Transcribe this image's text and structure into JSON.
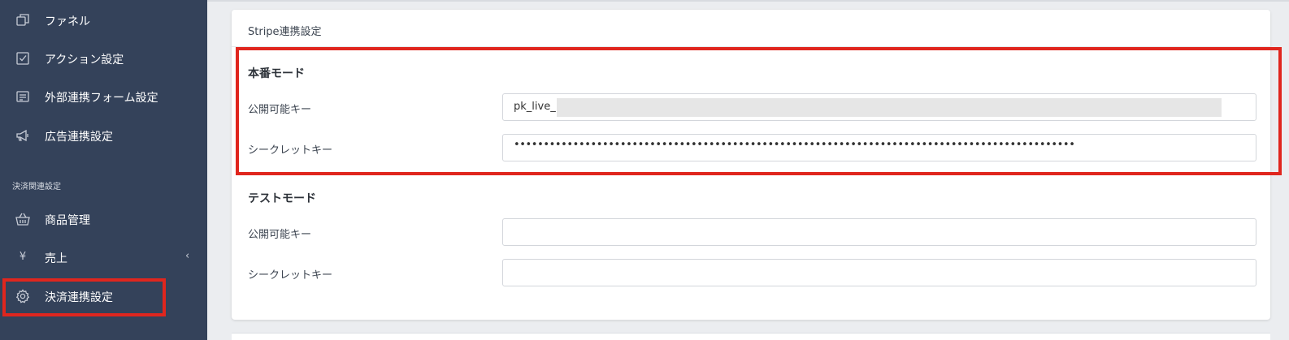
{
  "sidebar": {
    "items": [
      {
        "label": "ファネル",
        "icon": "copy-icon"
      },
      {
        "label": "アクション設定",
        "icon": "checkbox-icon"
      },
      {
        "label": "外部連携フォーム設定",
        "icon": "form-icon"
      },
      {
        "label": "広告連携設定",
        "icon": "megaphone-icon"
      }
    ],
    "section_label": "決済関連設定",
    "payment_items": [
      {
        "label": "商品管理",
        "icon": "basket-icon"
      },
      {
        "label": "売上",
        "icon": "yen-icon",
        "glyph": "¥",
        "chevron": "‹"
      },
      {
        "label": "決済連携設定",
        "icon": "gear-icon"
      }
    ]
  },
  "card": {
    "title": "Stripe連携設定",
    "live": {
      "title": "本番モード",
      "publishable_label": "公開可能キー",
      "publishable_value": "pk_live_",
      "secret_label": "シークレットキー",
      "secret_value": "•••••••••••••••••••••••••••••••••••••••••••••••••••••••••••••••••••••••••••••••••••••••••••••••••••••••••"
    },
    "test": {
      "title": "テストモード",
      "publishable_label": "公開可能キー",
      "publishable_value": "",
      "secret_label": "シークレットキー",
      "secret_value": ""
    }
  },
  "colors": {
    "sidebar_bg": "#34425a",
    "highlight": "#e0261e",
    "page_bg": "#ebedf0"
  }
}
